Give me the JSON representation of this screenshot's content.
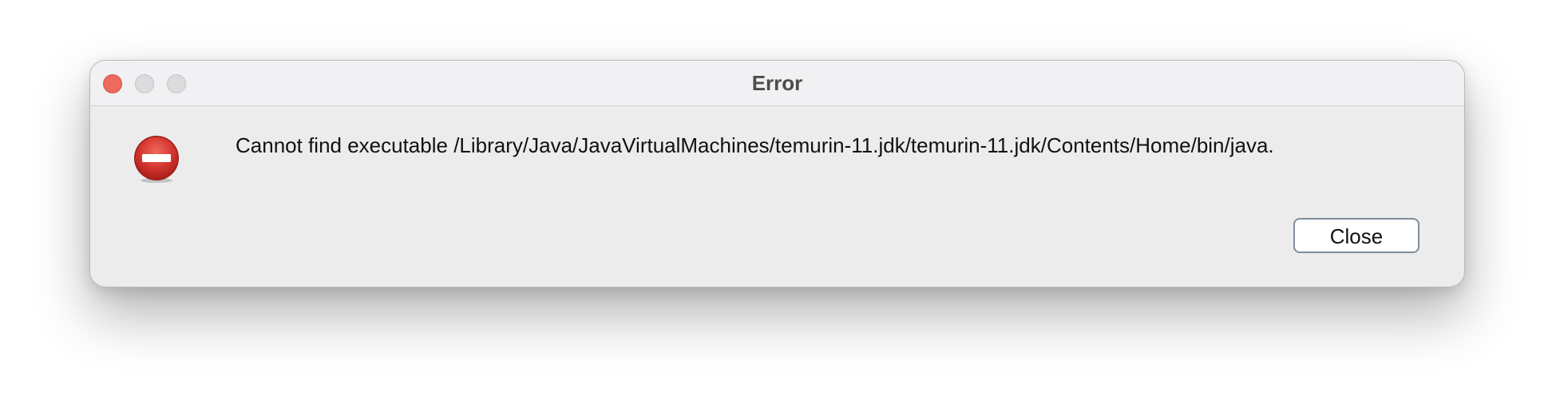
{
  "window": {
    "title": "Error"
  },
  "dialog": {
    "icon": "error-stop-icon",
    "message": "Cannot find executable /Library/Java/JavaVirtualMachines/temurin-11.jdk/temurin-11.jdk/Contents/Home/bin/java.",
    "close_label": "Close"
  },
  "colors": {
    "close_traffic_light": "#ed6a5e",
    "inactive_traffic_light": "#dcdbdd",
    "error_red": "#d2312c",
    "button_border": "#7f8e9e"
  }
}
